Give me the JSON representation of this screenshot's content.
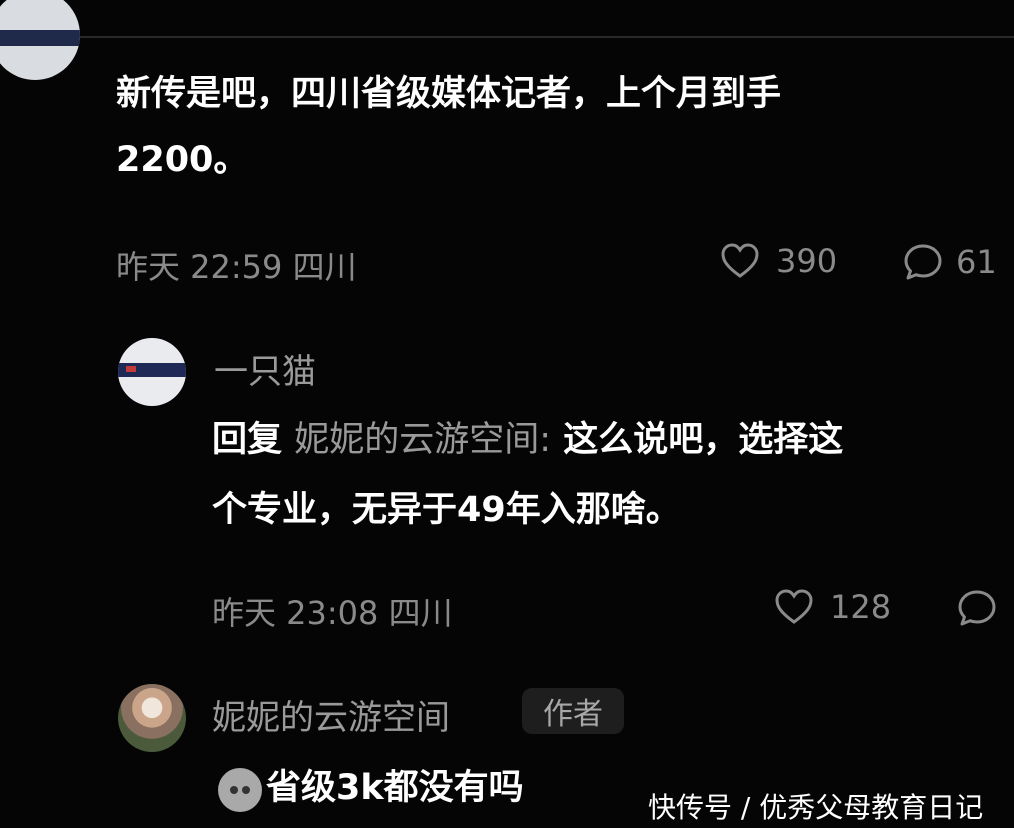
{
  "comments": [
    {
      "text_line1": "新传是吧，四川省级媒体记者，上个月到手",
      "text_line2": "2200。",
      "time": "昨天 22:59",
      "location": "四川",
      "likes": "390",
      "replies": "61"
    },
    {
      "username": "一只猫",
      "reply_prefix": "回复",
      "reply_target": "妮妮的云游空间:",
      "text_line1_rest": "这么说吧，选择这",
      "text_line2": "个专业，无异于49年入那啥。",
      "time": "昨天 23:08",
      "location": "四川",
      "likes": "128"
    },
    {
      "username": "妮妮的云游空间",
      "badge": "作者",
      "emoji": "grimace-emoji",
      "text": "省级3k都没有吗"
    }
  ],
  "watermark": "快传号 / 优秀父母教育日记",
  "icons": {
    "like": "heart-icon",
    "reply": "comment-bubble-icon"
  },
  "colors": {
    "background": "#050505",
    "primary_text": "#ffffff",
    "secondary_text": "#8a8a8a"
  }
}
